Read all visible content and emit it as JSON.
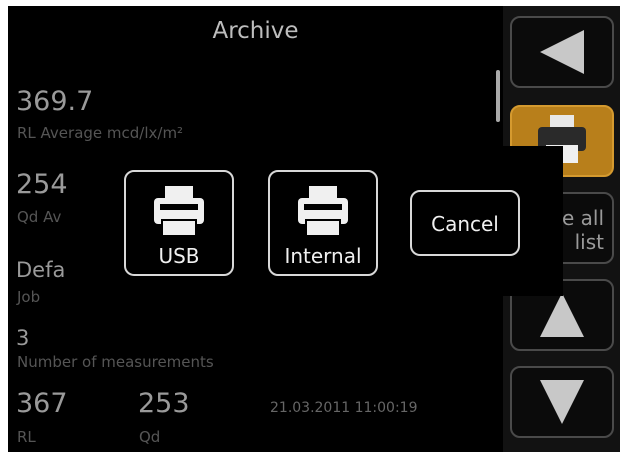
{
  "title": "Archive",
  "rl_average": {
    "value": "369.7",
    "label": "RL Average mcd/lx/m²"
  },
  "qd_average": {
    "value": "254",
    "label": "Qd Av"
  },
  "job": {
    "value": "Defa",
    "label": "Job"
  },
  "measurements": {
    "value": "3",
    "label": "Number of measurements"
  },
  "last": {
    "rl_value": "367",
    "rl_label": "RL",
    "qd_value": "253",
    "qd_label": "Qd",
    "timestamp": "21.03.2011  11:00:19"
  },
  "dialog": {
    "usb_label": "USB",
    "internal_label": "Internal",
    "cancel_label": "Cancel"
  },
  "sidebar": {
    "delete_label_line1": "te all",
    "delete_label_line2": "list"
  },
  "colors": {
    "print_accent": "#b87f1b"
  }
}
